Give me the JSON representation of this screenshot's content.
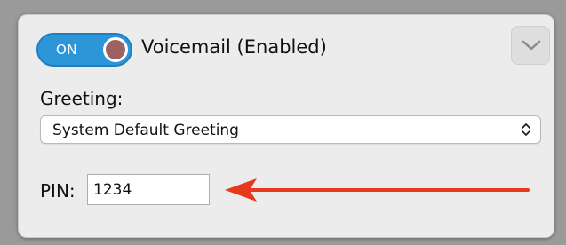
{
  "voicemail": {
    "toggle_label": "ON",
    "title": "Voicemail (Enabled)",
    "collapse_icon": "chevron-down-icon"
  },
  "greeting": {
    "label": "Greeting:",
    "selected": "System Default Greeting",
    "selector_icon": "up-down-arrows-icon"
  },
  "pin": {
    "label": "PIN:",
    "value": "1234"
  },
  "colors": {
    "toggle_on": "#2d96d8",
    "knob": "#9c6262",
    "annotation_arrow": "#e8391e"
  }
}
